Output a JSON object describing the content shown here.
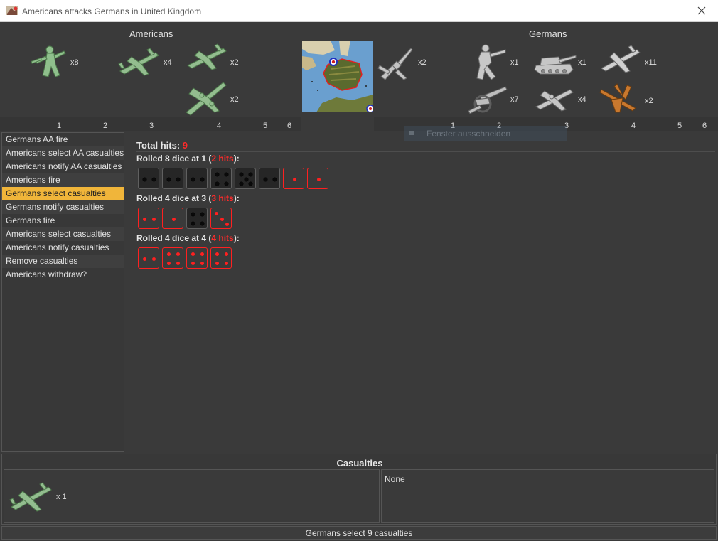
{
  "window": {
    "title": "Americans attacks Germans in United Kingdom",
    "close_icon": "close-icon"
  },
  "attacker": {
    "name": "Americans",
    "color": "#9cc69a",
    "units": [
      {
        "icon": "infantry-icon",
        "count": "x8"
      },
      {
        "icon": "fighter-icon",
        "count": "x4"
      },
      {
        "icon": "fighter-icon",
        "count": "x2"
      },
      {
        "icon": "bomber-icon",
        "count": "x2"
      }
    ],
    "columns": [
      "1",
      "2",
      "3",
      "4",
      "5",
      "6"
    ]
  },
  "territory": {
    "name": "United Kingdom map",
    "aa_unit": {
      "icon": "aa-gun-icon",
      "count": "x2"
    }
  },
  "defender": {
    "name": "Germans",
    "color": "#bdbdbd",
    "units": [
      {
        "icon": "infantry-icon",
        "count": "x1"
      },
      {
        "icon": "tank-icon",
        "count": "x1"
      },
      {
        "icon": "fighter-icon",
        "count": "x11"
      },
      {
        "icon": "artillery-icon",
        "count": "x7"
      },
      {
        "icon": "bomber-icon",
        "count": "x4"
      },
      {
        "icon": "fighter-orange-icon",
        "count": "x2"
      }
    ],
    "columns": [
      "1",
      "2",
      "3",
      "4",
      "5",
      "6"
    ]
  },
  "ghost_tooltip": "Fenster ausschneiden",
  "steps": [
    {
      "label": "Germans AA fire",
      "active": false
    },
    {
      "label": "Americans select AA casualties",
      "active": false
    },
    {
      "label": "Americans notify AA casualties",
      "active": false
    },
    {
      "label": "Americans fire",
      "active": false
    },
    {
      "label": "Germans select casualties",
      "active": true
    },
    {
      "label": "Germans notify casualties",
      "active": false
    },
    {
      "label": "Germans fire",
      "active": false
    },
    {
      "label": "Americans select casualties",
      "active": false
    },
    {
      "label": "Americans notify casualties",
      "active": false
    },
    {
      "label": "Remove casualties",
      "active": false
    },
    {
      "label": "Americans withdraw?",
      "active": false
    }
  ],
  "dice": {
    "total_label": "Total hits:",
    "total_hits": "9",
    "rolls": [
      {
        "label_prefix": "Rolled 8 dice at 1 (",
        "hits_text": "2 hits",
        "label_suffix": "):",
        "dice": [
          {
            "value": 2,
            "hit": false
          },
          {
            "value": 2,
            "hit": false
          },
          {
            "value": 2,
            "hit": false
          },
          {
            "value": 4,
            "hit": false
          },
          {
            "value": 5,
            "hit": false
          },
          {
            "value": 2,
            "hit": false
          },
          {
            "value": 1,
            "hit": true
          },
          {
            "value": 1,
            "hit": true
          }
        ]
      },
      {
        "label_prefix": "Rolled 4 dice at 3 (",
        "hits_text": "3 hits",
        "label_suffix": "):",
        "dice": [
          {
            "value": 2,
            "hit": true
          },
          {
            "value": 1,
            "hit": true
          },
          {
            "value": 4,
            "hit": false
          },
          {
            "value": 3,
            "hit": true
          }
        ]
      },
      {
        "label_prefix": "Rolled 4 dice at 4 (",
        "hits_text": "4 hits",
        "label_suffix": "):",
        "dice": [
          {
            "value": 2,
            "hit": true
          },
          {
            "value": 4,
            "hit": true
          },
          {
            "value": 4,
            "hit": true
          },
          {
            "value": 4,
            "hit": true
          }
        ]
      }
    ],
    "hit_color": "#ff2020"
  },
  "casualties": {
    "title": "Casualties",
    "attacker_units": [
      {
        "icon": "fighter-icon",
        "count": "x 1"
      }
    ],
    "defender_text": "None"
  },
  "status": {
    "label": "Germans select 9 casualties"
  }
}
